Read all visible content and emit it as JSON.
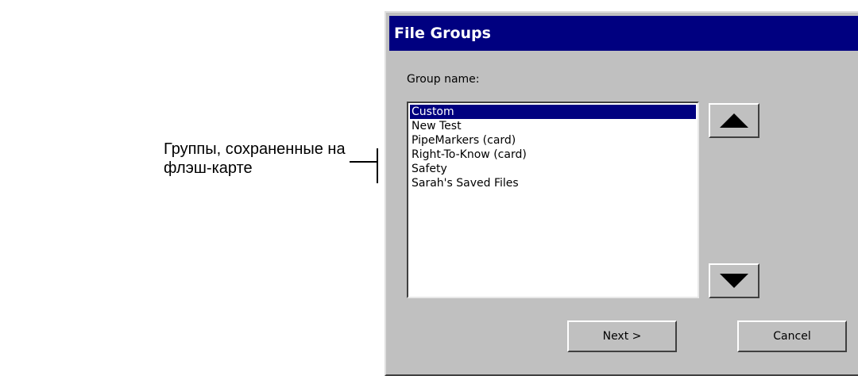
{
  "annotation": {
    "line1": "Группы, сохраненные на",
    "line2": "флэш-карте"
  },
  "dialog": {
    "title": "File Groups",
    "group_name_label": "Group name:",
    "groups": [
      "Custom",
      "New Test",
      "PipeMarkers (card)",
      "Right-To-Know (card)",
      "Safety",
      "Sarah's Saved Files"
    ],
    "selected_group": "Custom",
    "scroll_up_icon": "up-triangle",
    "scroll_down_icon": "down-triangle",
    "next_label": "Next >",
    "cancel_label": "Cancel",
    "colors": {
      "titlebar": "#000080",
      "face": "#c0c0c0",
      "selection": "#000080"
    }
  }
}
